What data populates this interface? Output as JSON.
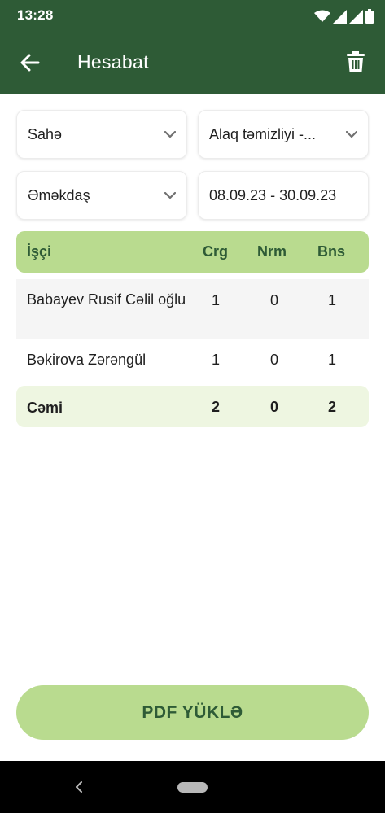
{
  "status_bar": {
    "time": "13:28"
  },
  "app_bar": {
    "title": "Hesabat",
    "back_icon": "arrow-left-icon",
    "delete_icon": "trash-icon"
  },
  "filters": {
    "field": {
      "value": "Sahə"
    },
    "work_type": {
      "value": "Alaq təmizliyi -..."
    },
    "employee": {
      "value": "Əməkdaş"
    },
    "date_range": {
      "value": "08.09.23 - 30.09.23"
    }
  },
  "table": {
    "headers": [
      "İşçi",
      "Crg",
      "Nrm",
      "Bns"
    ],
    "rows": [
      {
        "name": "Babayev Rusif Cəlil oğlu",
        "crg": "1",
        "nrm": "0",
        "bns": "1"
      },
      {
        "name": "Bəkirova Zərəngül",
        "crg": "1",
        "nrm": "0",
        "bns": "1"
      }
    ],
    "total": {
      "label": "Cəmi",
      "crg": "2",
      "nrm": "0",
      "bns": "2"
    }
  },
  "actions": {
    "pdf_label": "PDF YÜKLƏ"
  },
  "colors": {
    "primary": "#2e5b36",
    "accent": "#b9db8f",
    "total_bg": "#eef6e1"
  }
}
